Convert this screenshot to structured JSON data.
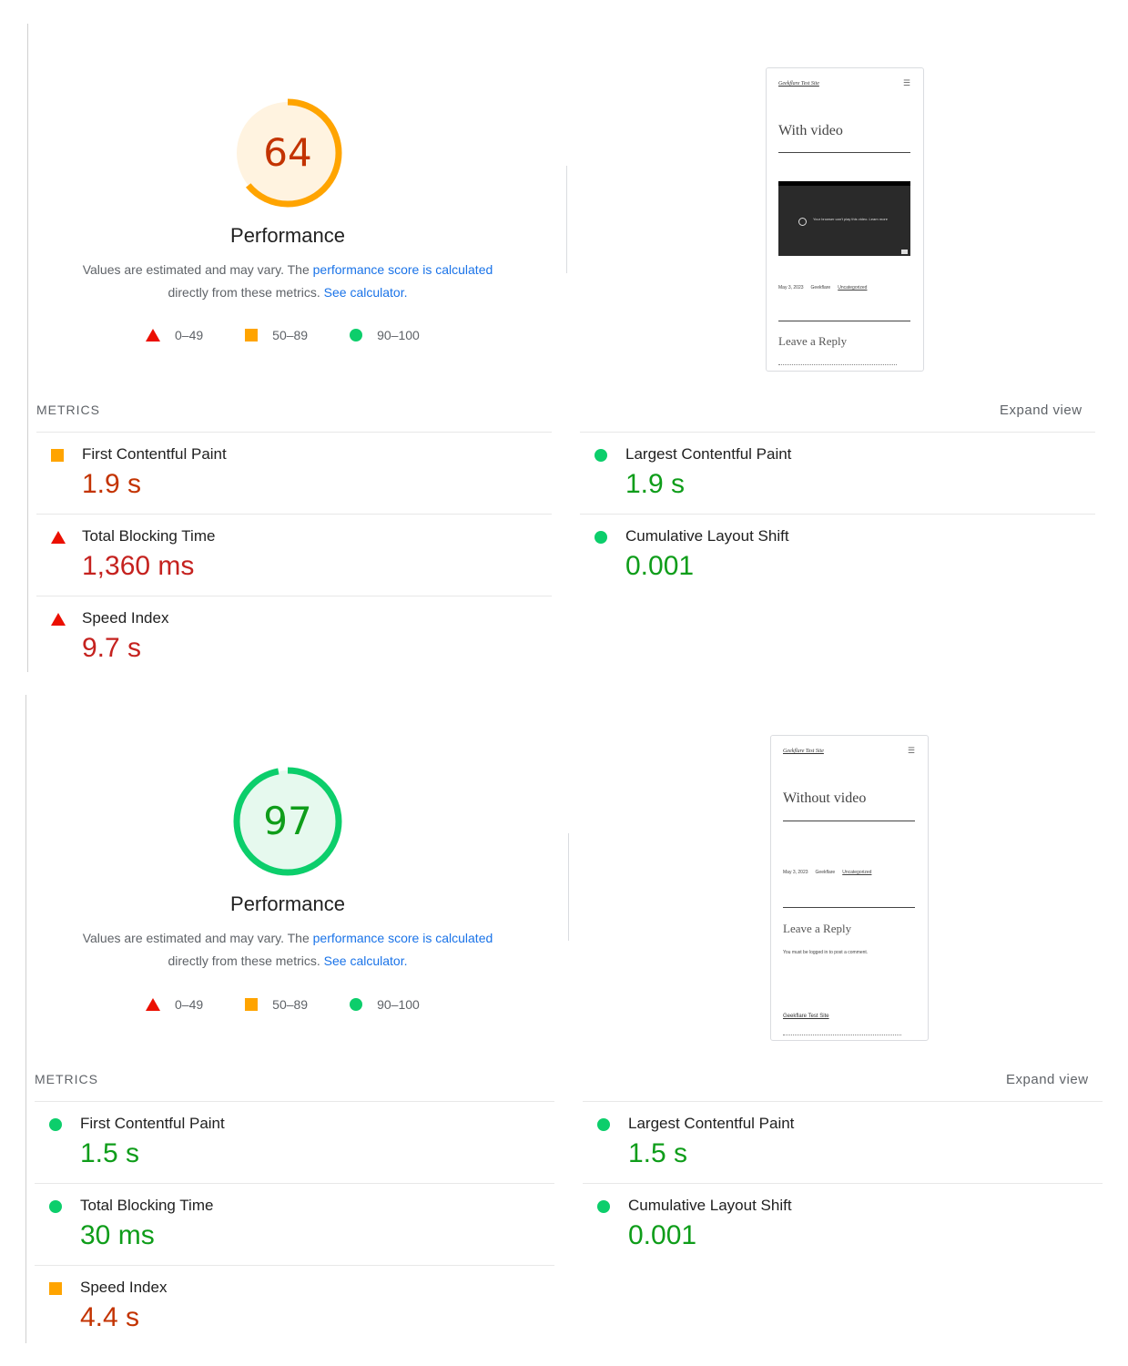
{
  "reports": [
    {
      "score": "64",
      "score_fraction": 0.64,
      "score_color": "#ffa400",
      "score_bg": "#fff3e0",
      "score_text_color": "#c33300",
      "title": "Performance",
      "desc_prefix": "Values are estimated and may vary. The ",
      "desc_link1": "performance score is calculated",
      "desc_middle": "directly from these metrics. ",
      "desc_link2": "See calculator.",
      "legend": [
        "0–49",
        "50–89",
        "90–100"
      ],
      "screenshot": {
        "site_name": "Geekflare Test Site",
        "heading": "With video",
        "video_message": "Your browser can't play this video. Learn more",
        "meta_date": "May 3, 2023",
        "meta_author": "Geekflare",
        "meta_category": "Uncategorized",
        "reply_heading": "Leave a Reply"
      },
      "metrics_label": "METRICS",
      "expand_label": "Expand view",
      "metrics": [
        {
          "name": "First Contentful Paint",
          "value": "1.9 s",
          "rating": "average"
        },
        {
          "name": "Largest Contentful Paint",
          "value": "1.9 s",
          "rating": "pass"
        },
        {
          "name": "Total Blocking Time",
          "value": "1,360 ms",
          "rating": "fail"
        },
        {
          "name": "Cumulative Layout Shift",
          "value": "0.001",
          "rating": "pass"
        },
        {
          "name": "Speed Index",
          "value": "9.7 s",
          "rating": "fail"
        }
      ]
    },
    {
      "score": "97",
      "score_fraction": 0.97,
      "score_color": "#0cce6b",
      "score_bg": "#e6f9ee",
      "score_text_color": "#0f9d1a",
      "title": "Performance",
      "desc_prefix": "Values are estimated and may vary. The ",
      "desc_link1": "performance score is calculated",
      "desc_middle": "directly from these metrics. ",
      "desc_link2": "See calculator.",
      "legend": [
        "0–49",
        "50–89",
        "90–100"
      ],
      "screenshot": {
        "site_name": "Geekflare Test Site",
        "heading": "Without video",
        "meta_date": "May 3, 2023",
        "meta_author": "Geekflare",
        "meta_category": "Uncategorized",
        "reply_heading": "Leave a Reply",
        "comment_note": "You must be logged in to post a comment.",
        "footer_site": "Geekflare Test Site"
      },
      "metrics_label": "METRICS",
      "expand_label": "Expand view",
      "metrics": [
        {
          "name": "First Contentful Paint",
          "value": "1.5 s",
          "rating": "pass"
        },
        {
          "name": "Largest Contentful Paint",
          "value": "1.5 s",
          "rating": "pass"
        },
        {
          "name": "Total Blocking Time",
          "value": "30 ms",
          "rating": "pass"
        },
        {
          "name": "Cumulative Layout Shift",
          "value": "0.001",
          "rating": "pass"
        },
        {
          "name": "Speed Index",
          "value": "4.4 s",
          "rating": "average"
        }
      ]
    }
  ]
}
